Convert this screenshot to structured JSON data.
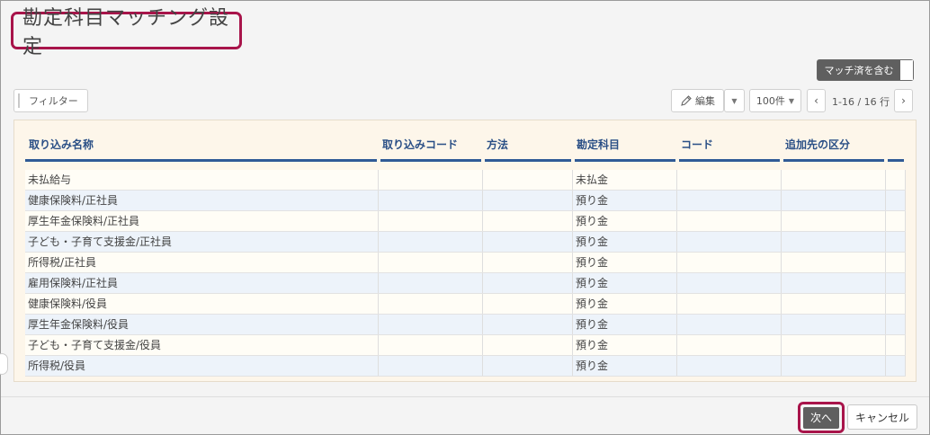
{
  "header": {
    "title": "勘定科目マッチング設定"
  },
  "toggle": {
    "label": "マッチ済を含む"
  },
  "toolbar": {
    "filter_label": "フィルター",
    "edit_label": "編集",
    "edit_icon": "pencil-icon",
    "per_page": "100件",
    "range": "1-16 / 16 行"
  },
  "table": {
    "columns": [
      "取り込み名称",
      "取り込みコード",
      "方法",
      "勘定科目",
      "コード",
      "追加先の区分"
    ],
    "rows": [
      [
        "未払給与",
        "",
        "",
        "未払金",
        "",
        ""
      ],
      [
        "健康保険料/正社員",
        "",
        "",
        "預り金",
        "",
        ""
      ],
      [
        "厚生年金保険料/正社員",
        "",
        "",
        "預り金",
        "",
        ""
      ],
      [
        "子ども・子育て支援金/正社員",
        "",
        "",
        "預り金",
        "",
        ""
      ],
      [
        "所得税/正社員",
        "",
        "",
        "預り金",
        "",
        ""
      ],
      [
        "雇用保険料/正社員",
        "",
        "",
        "預り金",
        "",
        ""
      ],
      [
        "健康保険料/役員",
        "",
        "",
        "預り金",
        "",
        ""
      ],
      [
        "厚生年金保険料/役員",
        "",
        "",
        "預り金",
        "",
        ""
      ],
      [
        "子ども・子育て支援金/役員",
        "",
        "",
        "預り金",
        "",
        ""
      ],
      [
        "所得税/役員",
        "",
        "",
        "預り金",
        "",
        ""
      ]
    ]
  },
  "footer": {
    "next_label": "次へ",
    "cancel_label": "キャンセル"
  },
  "colors": {
    "accent": "#a8144a",
    "header_text": "#2a4f86",
    "header_rule": "#2f5a96",
    "panel_bg": "#fdf6ea"
  }
}
